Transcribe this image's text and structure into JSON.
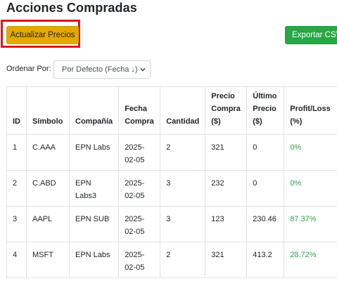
{
  "page": {
    "title": "Acciones Compradas"
  },
  "toolbar": {
    "update_label": "Actualizar Precios",
    "export_label": "Exportar CSV"
  },
  "sort": {
    "label": "Ordenar Por:",
    "selected": "Por Defecto (Fecha ↓)"
  },
  "table": {
    "headers": [
      "ID",
      "Símbolo",
      "Compañía",
      "Fecha Compra",
      "Cantidad",
      "Precio Compra ($)",
      "Último Precio ($)",
      "Profit/Loss (%)"
    ],
    "rows": [
      {
        "id": "1",
        "symbol": "C.AAA",
        "company": "EPN Labs",
        "date": "2025-02-05",
        "qty": "2",
        "buy_price": "321",
        "last_price": "0",
        "pl": "0%"
      },
      {
        "id": "2",
        "symbol": "C.ABD",
        "company": "EPN Labs3",
        "date": "2025-02-05",
        "qty": "3",
        "buy_price": "232",
        "last_price": "0",
        "pl": "0%"
      },
      {
        "id": "3",
        "symbol": "AAPL",
        "company": "EPN SUB",
        "date": "2025-02-05",
        "qty": "3",
        "buy_price": "123",
        "last_price": "230.46",
        "pl": "87.37%"
      },
      {
        "id": "4",
        "symbol": "MSFT",
        "company": "EPN Labs",
        "date": "2025-02-05",
        "qty": "2",
        "buy_price": "321",
        "last_price": "413.2",
        "pl": "28.72%"
      }
    ]
  },
  "colors": {
    "update_button": "#e4a800",
    "export_button": "#28a745",
    "highlight": "#e0151d",
    "profit_positive": "#28a745"
  }
}
